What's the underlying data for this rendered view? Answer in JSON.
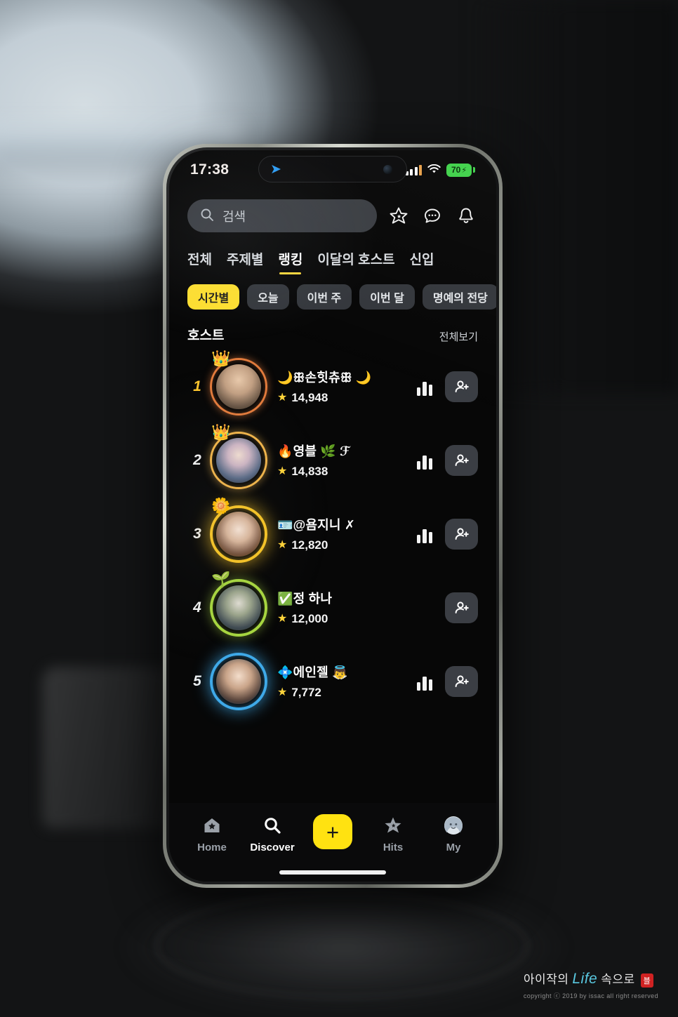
{
  "status_bar": {
    "time": "17:38",
    "location_icon": "navigation-arrow-icon",
    "signal_icon": "cellular-signal-icon",
    "wifi_icon": "wifi-icon",
    "battery_level": "70",
    "battery_charging": true
  },
  "app_top": {
    "search_placeholder": "검색",
    "search_value": "",
    "icons": [
      {
        "name": "sparkle-star-icon"
      },
      {
        "name": "chat-bubble-icon"
      },
      {
        "name": "bell-icon"
      }
    ]
  },
  "tabs": [
    {
      "label": "전체",
      "active": false
    },
    {
      "label": "주제별",
      "active": false
    },
    {
      "label": "랭킹",
      "active": true
    },
    {
      "label": "이달의 호스트",
      "active": false
    },
    {
      "label": "신입",
      "active": false
    }
  ],
  "chips": [
    {
      "label": "시간별",
      "active": true
    },
    {
      "label": "오늘",
      "active": false
    },
    {
      "label": "이번 주",
      "active": false
    },
    {
      "label": "이번 달",
      "active": false
    },
    {
      "label": "명예의 전당",
      "active": false
    }
  ],
  "section": {
    "title": "호스트",
    "more_label": "전체보기"
  },
  "ranking": [
    {
      "rank": "1",
      "name": "🌙ꕥ손힛츄ꕥ 🌙",
      "score": "14,948",
      "frame": "orange",
      "crown": "👑",
      "has_chart": true,
      "has_add": true
    },
    {
      "rank": "2",
      "name": "🔥영블 🌿 ℱ",
      "score": "14,838",
      "frame": "gold",
      "crown": "👑",
      "has_chart": true,
      "has_add": true
    },
    {
      "rank": "3",
      "name": "🪪@욤지니 ✗",
      "score": "12,820",
      "frame": "yellow",
      "crown": "🌼",
      "has_chart": true,
      "has_add": true
    },
    {
      "rank": "4",
      "name": "✅정 하나",
      "score": "12,000",
      "frame": "green",
      "crown": "🌱",
      "has_chart": false,
      "has_add": true
    },
    {
      "rank": "5",
      "name": "💠에인젤 👼",
      "score": "7,772",
      "frame": "blue",
      "crown": "",
      "has_chart": true,
      "has_add": true
    }
  ],
  "bottom_nav": [
    {
      "label": "Home",
      "icon": "home-star-icon",
      "active": false
    },
    {
      "label": "Discover",
      "icon": "search-icon",
      "active": true
    },
    {
      "label": "",
      "icon": "plus-icon",
      "active": false,
      "is_plus": true
    },
    {
      "label": "Hits",
      "icon": "sparkle-star-icon",
      "active": false
    },
    {
      "label": "My",
      "icon": "profile-avatar-icon",
      "active": false
    }
  ],
  "watermark": {
    "prefix": "아이작의",
    "life": "Life",
    "suffix": "속으로",
    "badge": "블",
    "copyright": "copyright ⓒ 2019 by issac all right reserved"
  },
  "colors": {
    "accent_yellow": "#ffe030",
    "star_gold": "#ffd43a",
    "battery_green": "#3fd24a",
    "chip_bg": "#34373c"
  }
}
